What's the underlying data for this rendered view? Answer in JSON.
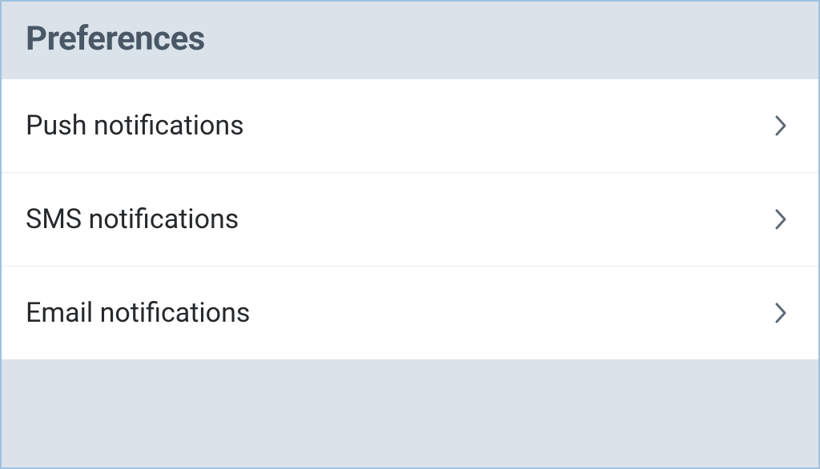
{
  "header": {
    "title": "Preferences"
  },
  "items": [
    {
      "label": "Push notifications"
    },
    {
      "label": "SMS notifications"
    },
    {
      "label": "Email notifications"
    }
  ]
}
